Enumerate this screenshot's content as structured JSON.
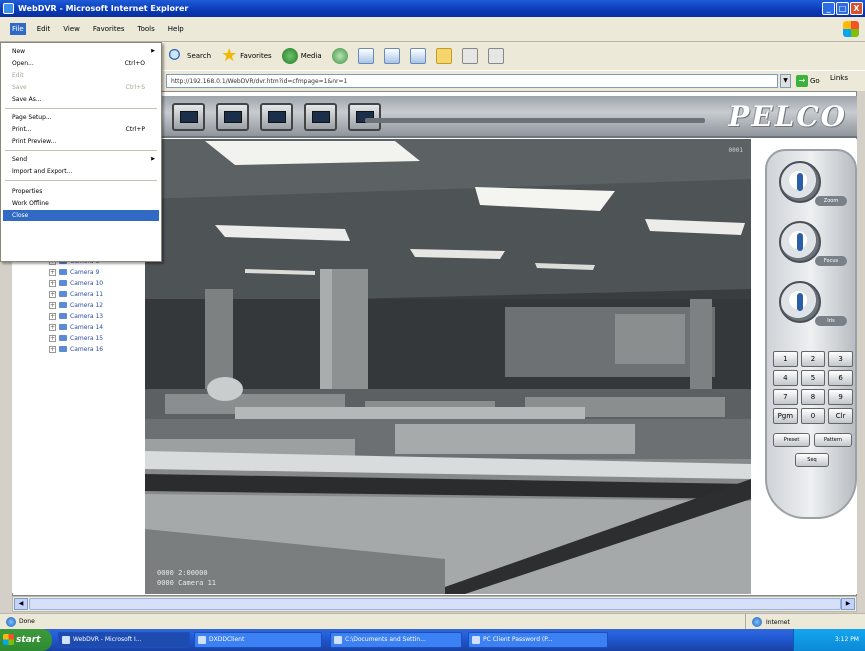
{
  "window": {
    "title": "WebDVR - Microsoft Internet Explorer",
    "controls": [
      "_",
      "□",
      "X"
    ]
  },
  "menubar": {
    "items": [
      "File",
      "Edit",
      "View",
      "Favorites",
      "Tools",
      "Help"
    ]
  },
  "toolbar": {
    "search_label": "Search",
    "favorites_label": "Favorites",
    "media_label": "Media"
  },
  "address": {
    "url": "http://192.168.0.1/WebDVR/dvr.htm?id=cfmpage=1&nr=1",
    "go_label": "Go",
    "links_label": "Links"
  },
  "file_menu": {
    "items": [
      {
        "label": "New",
        "shortcut": "",
        "submenu": true,
        "disabled": false
      },
      {
        "label": "Open...",
        "shortcut": "Ctrl+O",
        "submenu": false,
        "disabled": false
      },
      {
        "label": "Edit",
        "shortcut": "",
        "submenu": false,
        "disabled": true
      },
      {
        "label": "Save",
        "shortcut": "Ctrl+S",
        "submenu": false,
        "disabled": true
      },
      {
        "label": "Save As...",
        "shortcut": "",
        "submenu": false,
        "disabled": false
      },
      {
        "label": "Page Setup...",
        "shortcut": "",
        "submenu": false,
        "disabled": false
      },
      {
        "label": "Print...",
        "shortcut": "Ctrl+P",
        "submenu": false,
        "disabled": false
      },
      {
        "label": "Print Preview...",
        "shortcut": "",
        "submenu": false,
        "disabled": false
      },
      {
        "label": "Send",
        "shortcut": "",
        "submenu": true,
        "disabled": false
      },
      {
        "label": "Import and Export...",
        "shortcut": "",
        "submenu": false,
        "disabled": false
      },
      {
        "label": "Properties",
        "shortcut": "",
        "submenu": false,
        "disabled": false
      },
      {
        "label": "Work Offline",
        "shortcut": "",
        "submenu": false,
        "disabled": false
      },
      {
        "label": "Close",
        "shortcut": "",
        "submenu": false,
        "disabled": false
      }
    ]
  },
  "camera_toolbar": {
    "logo": "PELCO"
  },
  "camera_tree": {
    "items": [
      "Camera 8",
      "Camera 9",
      "Camera 10",
      "Camera 11",
      "Camera 12",
      "Camera 13",
      "Camera 14",
      "Camera 15",
      "Camera 16"
    ]
  },
  "video": {
    "overlay_line1": "0000 2:00000",
    "overlay_line2": "0000 Camera 11",
    "top_right": "0001"
  },
  "ptz": {
    "knob_labels": [
      "Zoom",
      "Focus",
      "Iris"
    ],
    "keypad": [
      "1",
      "2",
      "3",
      "4",
      "5",
      "6",
      "7",
      "8",
      "9",
      "Pgm",
      "0",
      "Clr"
    ],
    "preset_label": "Preset",
    "pattern_label": "Pattern",
    "seq_label": "Seq"
  },
  "statusbar": {
    "left_text": "Done",
    "zone_text": "Internet"
  },
  "taskbar": {
    "start_label": "start",
    "tasks": [
      "WebDVR - Microsoft I...",
      "DXDDClient",
      "C:\\Documents and Settin...",
      "PC Client Password (P..."
    ],
    "clock": "3:12 PM"
  },
  "colors": {
    "xp_blue": "#0a3ab8",
    "menu_highlight": "#316ac5",
    "taskbar_green": "#3c9a3c"
  }
}
